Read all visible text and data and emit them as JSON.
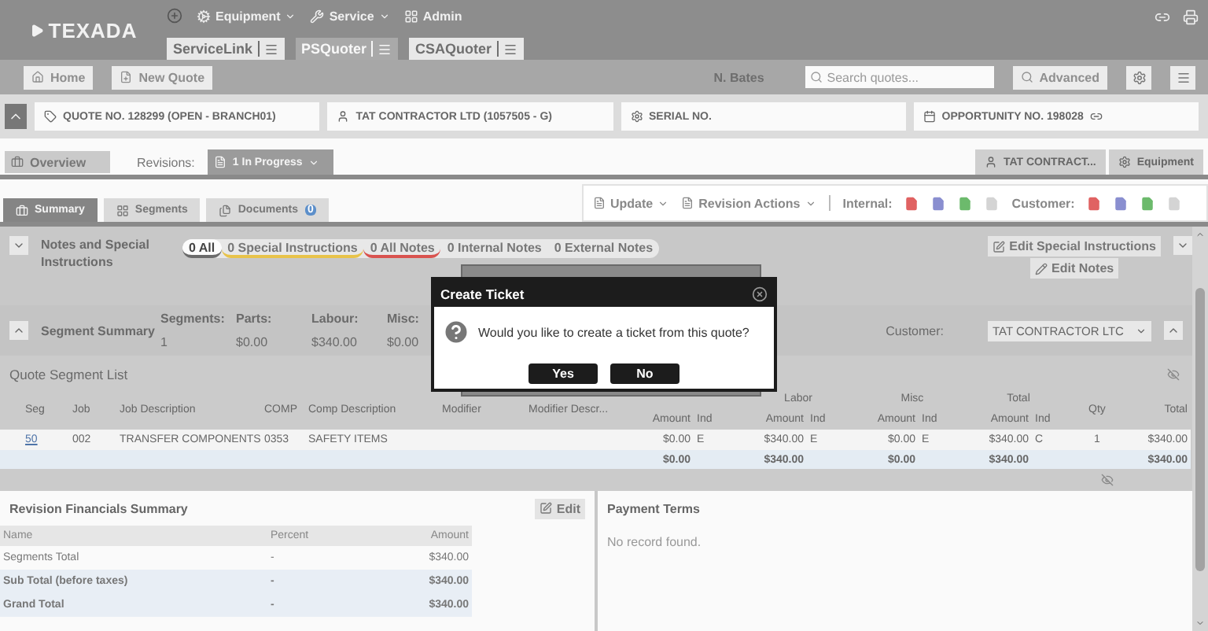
{
  "header": {
    "logo": "TEXADA",
    "nav": [
      {
        "kind": "add"
      },
      {
        "kind": "equipment",
        "label": "Equipment",
        "dropdown": true
      },
      {
        "kind": "service",
        "label": "Service",
        "dropdown": true
      },
      {
        "kind": "admin",
        "label": "Admin",
        "dropdown": false
      }
    ],
    "apps": [
      {
        "label": "ServiceLink",
        "selected": false
      },
      {
        "label": "PSQuoter",
        "selected": true
      },
      {
        "label": "CSAQuoter",
        "selected": false
      }
    ]
  },
  "toolbar": {
    "buttons": [
      {
        "kind": "home",
        "label": "Home"
      },
      {
        "kind": "new",
        "label": "New Quote"
      }
    ],
    "user": "N. Bates",
    "search": {
      "placeholder": "Search quotes..."
    },
    "advanced": "Advanced"
  },
  "info": [
    {
      "kind": "tag",
      "label": "QUOTE NO. 128299 (OPEN - BRANCH01)"
    },
    {
      "kind": "user",
      "label": "TAT CONTRACTOR LTD (1057505 - G)"
    },
    {
      "kind": "gear",
      "label": "SERIAL NO."
    },
    {
      "kind": "calendar",
      "label": "OPPORTUNITY NO. 198028"
    }
  ],
  "revision_bar": {
    "overview": "Overview",
    "revisions_label": "Revisions:",
    "revision": "1 In Progress",
    "right": [
      {
        "kind": "user",
        "label": "TAT CONTRACT..."
      },
      {
        "kind": "gear",
        "label": "Equipment"
      }
    ]
  },
  "tabs": [
    {
      "label": "Summary",
      "selected": true,
      "kind": "summary"
    },
    {
      "label": "Segments",
      "selected": false,
      "kind": "segments"
    },
    {
      "label": "Documents",
      "selected": false,
      "kind": "documents",
      "badge": "0"
    }
  ],
  "actions": {
    "update": "Update",
    "revision_actions": "Revision Actions",
    "internal": "Internal:",
    "customer": "Customer:",
    "internal_exports": [
      {
        "color": "#e06262"
      },
      {
        "color": "#8a8fd0"
      },
      {
        "color": "#6cba6c"
      },
      {
        "color": "#d4d4d4"
      }
    ],
    "customer_exports": [
      {
        "color": "#e06262"
      },
      {
        "color": "#8a8fd0"
      },
      {
        "color": "#6cba6c"
      },
      {
        "color": "#d4d4d4"
      }
    ]
  },
  "notes": {
    "title": "Notes and Special Instructions",
    "expanded": false,
    "filters": [
      {
        "label": "0 All",
        "selected": true,
        "color": "#6b6b6b"
      },
      {
        "label": "0 Special Instructions",
        "selected": false,
        "color": "#e8c34a"
      },
      {
        "label": "0 All Notes",
        "selected": false,
        "color": "#d9534f"
      },
      {
        "label": "0 Internal Notes",
        "selected": false
      },
      {
        "label": "0 External Notes",
        "selected": false
      }
    ],
    "edit_special": "Edit Special Instructions",
    "edit_notes": "Edit Notes"
  },
  "segment_summary": {
    "title": "Segment Summary",
    "expanded": true,
    "stats": [
      {
        "label": "Segments:",
        "value": "1"
      },
      {
        "label": "Parts:",
        "value": "$0.00"
      },
      {
        "label": "Labour:",
        "value": "$340.00"
      },
      {
        "label": "Misc:",
        "value": "$0.00"
      }
    ],
    "customer_label": "Customer:",
    "customer": "TAT CONTRACTOR LTC"
  },
  "segment_list": {
    "title": "Quote Segment List",
    "columns": [
      {
        "kind": "tall",
        "label": "Seg"
      },
      {
        "kind": "tall",
        "label": "Job"
      },
      {
        "kind": "tall",
        "label": "Job Description"
      },
      {
        "kind": "tall",
        "label": "COMP"
      },
      {
        "kind": "tall",
        "label": "Comp Description"
      },
      {
        "kind": "tall",
        "label": "Modifier"
      },
      {
        "kind": "tall",
        "label": "Modifier Descr..."
      },
      {
        "kind": "sub",
        "label": "Amount"
      },
      {
        "kind": "sub",
        "label": "Ind"
      },
      {
        "kind": "sub",
        "label": "Amount",
        "group": "Labor"
      },
      {
        "kind": "sub",
        "label": "Ind"
      },
      {
        "kind": "sub",
        "label": "Amount",
        "group": "Misc"
      },
      {
        "kind": "sub",
        "label": "Ind"
      },
      {
        "kind": "sub",
        "label": "Amount",
        "group": "Total"
      },
      {
        "kind": "sub",
        "label": "Ind"
      },
      {
        "kind": "tall",
        "label": "Qty"
      },
      {
        "kind": "tall",
        "label": "Total"
      }
    ],
    "rows": [
      {
        "kind": "data",
        "cells": [
          "50",
          "002",
          "TRANSFER COMPONENTS",
          "0353",
          "SAFETY ITEMS",
          null,
          null,
          "$0.00",
          "E",
          "$340.00",
          "E",
          "$0.00",
          "E",
          "$340.00",
          "C",
          "1",
          "$340.00"
        ]
      },
      {
        "kind": "total",
        "cells": [
          null,
          null,
          null,
          null,
          null,
          null,
          null,
          "$0.00",
          null,
          "$340.00",
          null,
          "$0.00",
          null,
          "$340.00",
          null,
          null,
          "$340.00"
        ]
      }
    ]
  },
  "financials": {
    "title": "Revision Financials Summary",
    "edit": "Edit",
    "columns": [
      "Name",
      "Percent",
      "Amount"
    ],
    "rows": [
      {
        "kind": "normal",
        "cells": [
          "Segments Total",
          "-",
          "$340.00"
        ]
      },
      {
        "kind": "bold",
        "cells": [
          "Sub Total (before taxes)",
          "-",
          "$340.00"
        ]
      },
      {
        "kind": "bold",
        "cells": [
          "Grand Total",
          "-",
          "$340.00"
        ]
      }
    ]
  },
  "payment_terms": {
    "title": "Payment Terms",
    "empty": "No record found."
  },
  "dialog": {
    "title": "Create Ticket",
    "message": "Would you like to create a ticket from this quote?",
    "buttons": [
      "Yes",
      "No"
    ]
  }
}
